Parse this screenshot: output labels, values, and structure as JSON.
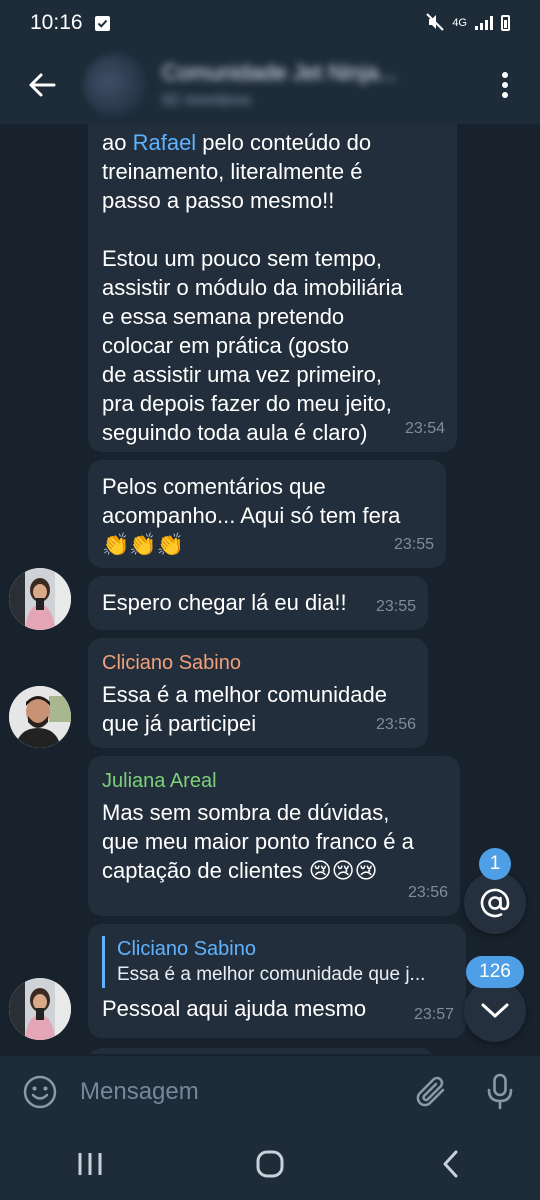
{
  "status_bar": {
    "time": "10:16",
    "network": "4G"
  },
  "header": {
    "title": "Comunidade Jet Ninja...",
    "subtitle": "92 membros"
  },
  "messages": [
    {
      "id": "m1",
      "prefix": "ao ",
      "link": "Rafael",
      "text": " pelo conteúdo do\ntreinamento, literalmente é\npasso a passo mesmo!!\n\nEstou um pouco sem tempo,\nassistir o módulo da imobiliária\ne essa semana pretendo\ncolocar em prática (gosto\nde assistir uma vez primeiro,\npra depois fazer do meu jeito,\nseguindo toda aula é claro)",
      "time": "23:54"
    },
    {
      "id": "m2",
      "text": "Pelos comentários que\nacompanho... Aqui só tem fera\n👏👏👏",
      "time": "23:55"
    },
    {
      "id": "m3",
      "text": "Espero chegar lá eu dia!!",
      "time": "23:55"
    },
    {
      "id": "m4",
      "sender": "Cliciano Sabino",
      "sender_color": "#f0a07a",
      "text": "Essa é a melhor comunidade\nque já participei",
      "time": "23:56"
    },
    {
      "id": "m5",
      "sender": "Juliana Areal",
      "sender_color": "#7ed07a",
      "text": "Mas sem sombra de dúvidas,\nque meu maior ponto franco é a\ncaptação de clientes 😢😢😢",
      "time": "23:56"
    },
    {
      "id": "m6",
      "reply_to_name": "Cliciano Sabino",
      "reply_to_text": "Essa é a melhor comunidade que j...",
      "text": "Pessoal aqui ajuda mesmo",
      "time": "23:57"
    }
  ],
  "fabs": {
    "mentions_count": "1",
    "unread_count": "126"
  },
  "input": {
    "placeholder": "Mensagem"
  },
  "colors": {
    "background": "#18222d",
    "bubble": "#222e3b",
    "header": "#1e2c3a",
    "accent": "#4e9fe5",
    "link": "#5fb3ff"
  }
}
